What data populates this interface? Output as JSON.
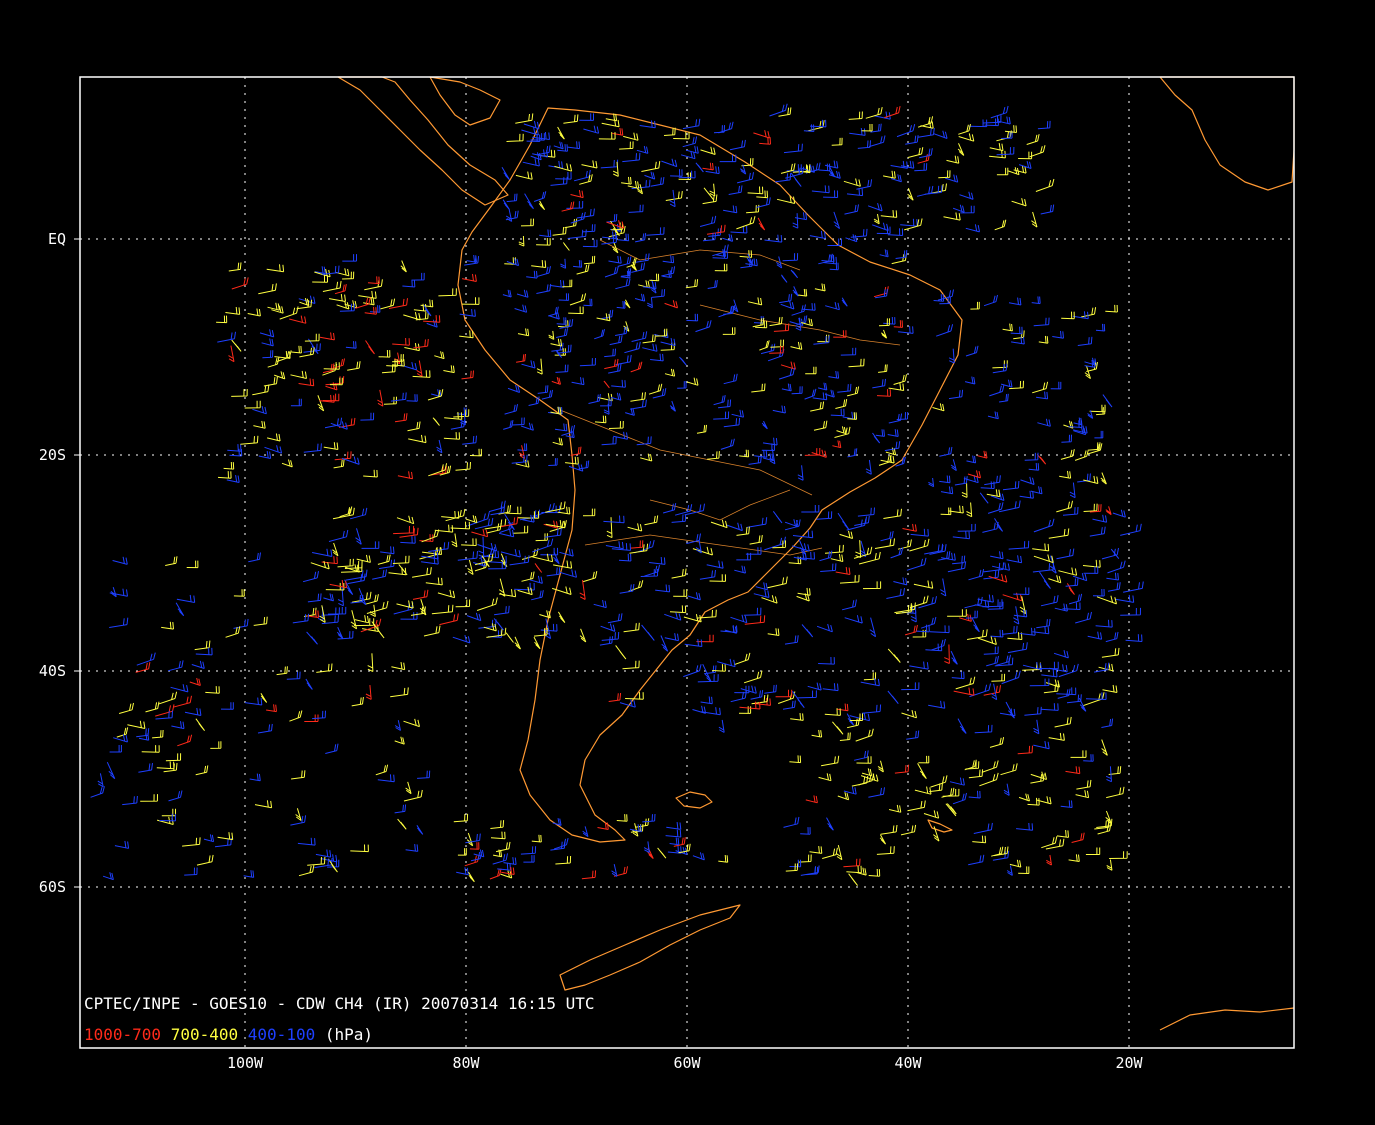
{
  "map": {
    "caption": "CPTEC/INPE - GOES10 - CDW CH4 (IR) 20070314 16:15 UTC",
    "legend": [
      {
        "label": "1000-700",
        "color": "#ff2a1a"
      },
      {
        "label": "700-400",
        "color": "#ffff40"
      },
      {
        "label": "400-100",
        "color": "#1e40ff"
      },
      {
        "label": "(hPa)",
        "color": "#ffffff"
      }
    ],
    "lon_labels": [
      "100W",
      "80W",
      "60W",
      "40W",
      "20W"
    ],
    "lat_labels": [
      "EQ",
      "20S",
      "40S",
      "60S"
    ],
    "coast_color": "#ff9933",
    "grid_color": "#ffffff"
  }
}
